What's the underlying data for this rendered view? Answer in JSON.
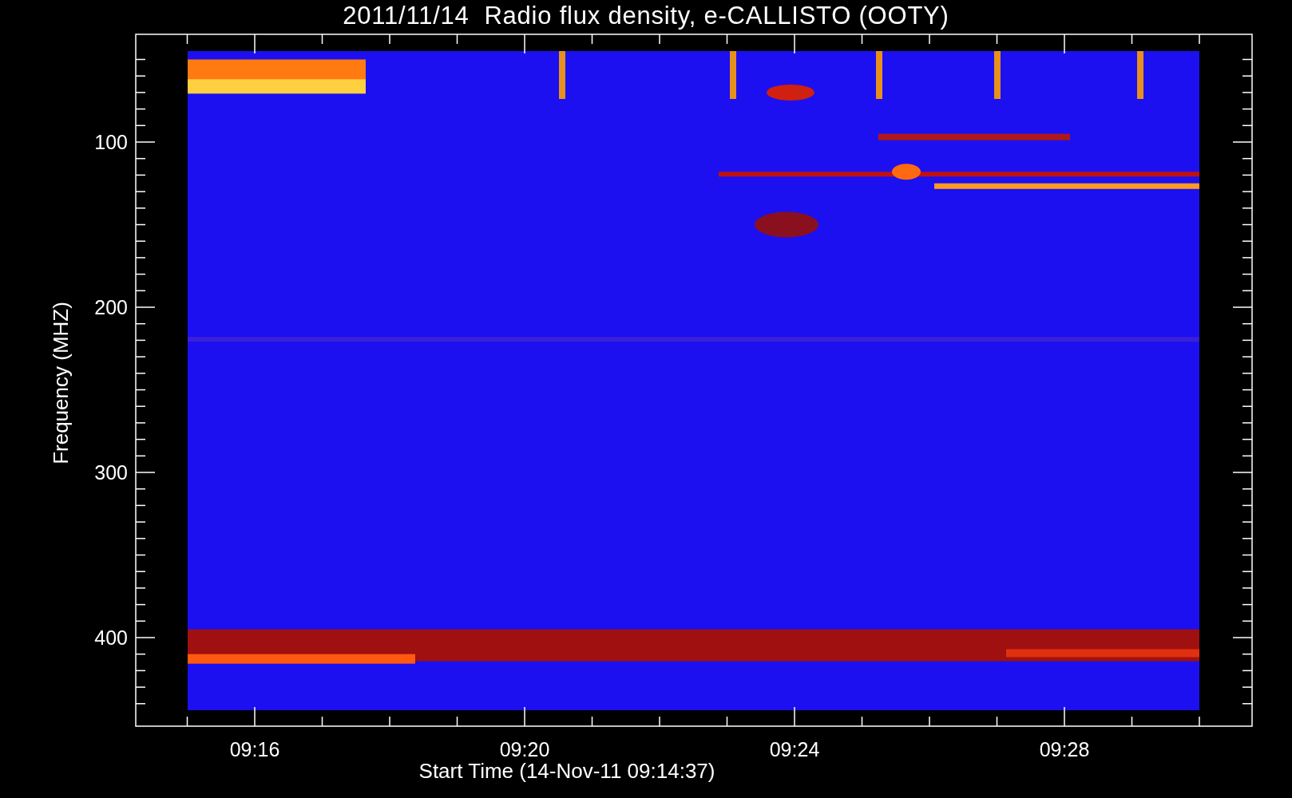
{
  "plot": {
    "title": "2011/11/14  Radio flux density, e-CALLISTO (OOTY)",
    "ylabel": "Frequency (MHZ)",
    "xlabel": "Start Time (14-Nov-11 09:14:37)",
    "yticks": [
      "100",
      "200",
      "300",
      "400"
    ],
    "xticks": [
      "09:16",
      "09:20",
      "09:24",
      "09:28"
    ]
  }
}
